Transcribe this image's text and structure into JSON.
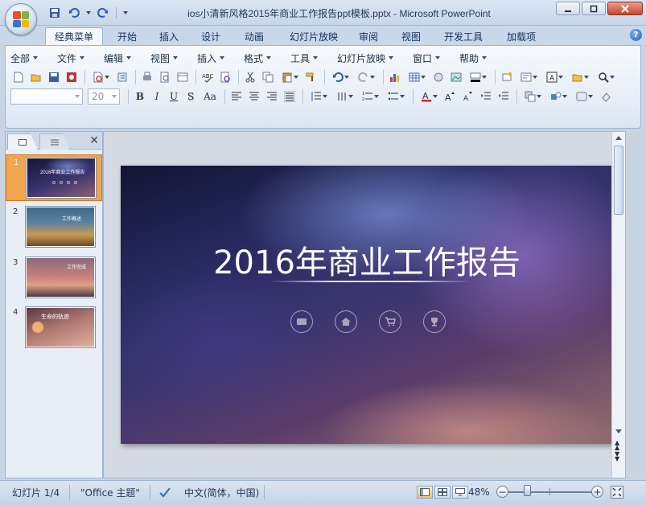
{
  "window": {
    "title": "ios小清新风格2015年商业工作报告ppt模板.pptx - Microsoft PowerPoint"
  },
  "ribbon_tabs": [
    {
      "label": "经典菜单",
      "active": true
    },
    {
      "label": "开始"
    },
    {
      "label": "插入"
    },
    {
      "label": "设计"
    },
    {
      "label": "动画"
    },
    {
      "label": "幻灯片放映"
    },
    {
      "label": "审阅"
    },
    {
      "label": "视图"
    },
    {
      "label": "开发工具"
    },
    {
      "label": "加载项"
    }
  ],
  "menu": [
    "全部",
    "文件",
    "编辑",
    "视图",
    "插入",
    "格式",
    "工具",
    "幻灯片放映",
    "窗口",
    "帮助"
  ],
  "font": {
    "name_value": "",
    "size_value": "20"
  },
  "format_buttons": [
    "B",
    "I",
    "U",
    "S",
    "Aa"
  ],
  "slides": [
    {
      "number": "1",
      "label": "2016年商业工作报告",
      "selected": true
    },
    {
      "number": "2",
      "label": "工作概述"
    },
    {
      "number": "3",
      "label": "工作完成"
    },
    {
      "number": "4",
      "label": "生命的轨迹"
    }
  ],
  "current_slide": {
    "title": "2016年商业工作报告",
    "icons": [
      "mail-icon",
      "home-icon",
      "cart-icon",
      "trophy-icon"
    ]
  },
  "status": {
    "slide_info": "幻灯片 1/4",
    "theme": "\"Office 主题\"",
    "language": "中文(简体，中国)",
    "zoom": "48%"
  },
  "colors": {
    "accent": "#f0a54e",
    "ribbon": "#dbe6f3"
  }
}
